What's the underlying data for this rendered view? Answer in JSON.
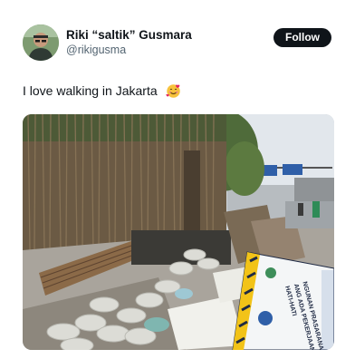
{
  "tweet": {
    "author": {
      "display_name": "Riki “saltik” Gusmara",
      "handle": "@rikigusma"
    },
    "follow_label": "Follow",
    "text": "I love walking in Jakarta",
    "emoji_icon": "smiling-face-with-hearts-icon"
  },
  "photo": {
    "banner_text": [
      "HATI-HATI",
      "ANG ADA PEKERJAAN",
      "NGUNAN PRASARANA"
    ]
  }
}
